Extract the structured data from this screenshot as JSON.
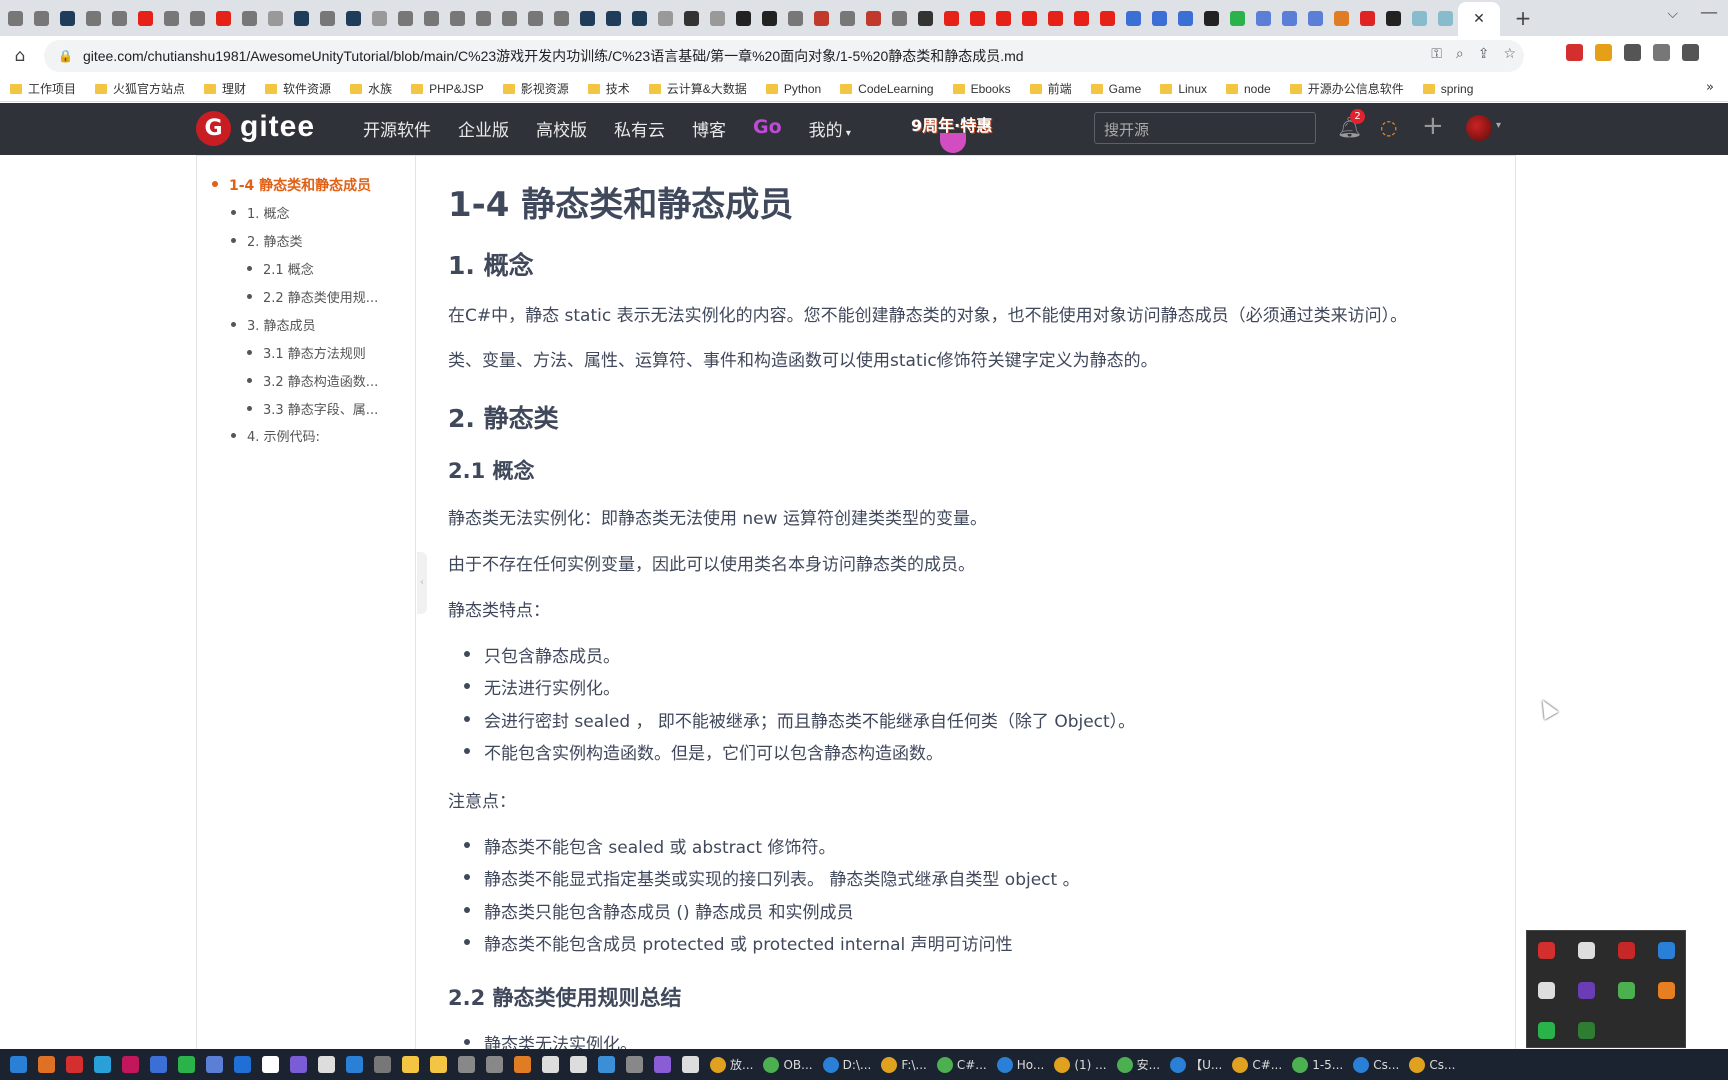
{
  "browser": {
    "active_tab_close": "✕",
    "new_tab": "+",
    "tab_list": "⌵",
    "minimize": "—",
    "url": "gitee.com/chutianshu1981/AwesomeUnityTutorial/blob/main/C%23游戏开发内功训练/C%23语言基础/第一章%20面向对象/1-5%20静态类和静态成员.md",
    "bookmarks": [
      "工作项目",
      "火狐官方站点",
      "理财",
      "软件资源",
      "水族",
      "PHP&JSP",
      "影视资源",
      "技术",
      "云计算&大数据",
      "Python",
      "CodeLearning",
      "Ebooks",
      "前端",
      "Game",
      "Linux",
      "node",
      "开源办公信息软件",
      "spring"
    ],
    "bookmarks_more": "»",
    "tab_favicon_colors": [
      "#777",
      "#777",
      "#1f3d5a",
      "#777",
      "#777",
      "#e62117",
      "#777",
      "#777",
      "#e62117",
      "#777",
      "#999",
      "#1f3d5a",
      "#777",
      "#1f3d5a",
      "#999",
      "#777",
      "#777",
      "#777",
      "#777",
      "#777",
      "#777",
      "#777",
      "#1f3d5a",
      "#1f3d5a",
      "#1f3d5a",
      "#999",
      "#333",
      "#999",
      "#222",
      "#222",
      "#777",
      "#c0392b",
      "#777",
      "#c0392b",
      "#777",
      "#333",
      "#e62117",
      "#e62117",
      "#e62117",
      "#e62117",
      "#e62117",
      "#e62117",
      "#e62117",
      "#3b6fd6",
      "#3b6fd6",
      "#3b6fd6",
      "#222",
      "#2ab34a",
      "#5b7fd6",
      "#5b7fd6",
      "#5b7fd6",
      "#e07c24",
      "#e02424",
      "#222",
      "#8bc",
      "#8bc"
    ],
    "ext_colors": [
      "#d32f2f",
      "#e6a017",
      "#555",
      "#777",
      "#555"
    ]
  },
  "gitee": {
    "logo_text": "gitee",
    "nav": [
      "开源软件",
      "企业版",
      "高校版",
      "私有云",
      "博客"
    ],
    "nav_go": "Go",
    "nav_mine": "我的",
    "promo": "9周年·特惠",
    "search_placeholder": "搜开源",
    "notifications": "2"
  },
  "toc": [
    {
      "label": "1-4 静态类和静态成员",
      "level": 1
    },
    {
      "label": "1. 概念",
      "level": 2
    },
    {
      "label": "2. 静态类",
      "level": 2
    },
    {
      "label": "2.1 概念",
      "level": 3
    },
    {
      "label": "2.2 静态类使用规...",
      "level": 3
    },
    {
      "label": "3. 静态成员",
      "level": 2
    },
    {
      "label": "3.1 静态方法规则",
      "level": 3
    },
    {
      "label": "3.2 静态构造函数...",
      "level": 3
    },
    {
      "label": "3.3 静态字段、属...",
      "level": 3
    },
    {
      "label": "4. 示例代码:",
      "level": 2
    }
  ],
  "doc": {
    "title": "1-4 静态类和静态成员",
    "s1_heading": "1. 概念",
    "s1_p1": "在C#中，静态 static 表示无法实例化的内容。您不能创建静态类的对象，也不能使用对象访问静态成员（必须通过类来访问）。",
    "s1_p2": "类、变量、方法、属性、运算符、事件和构造函数可以使用static修饰符关键字定义为静态的。",
    "s2_heading": "2. 静态类",
    "s21_heading": "2.1 概念",
    "s21_p1": "静态类无法实例化：即静态类无法使用 new 运算符创建类类型的变量。",
    "s21_p2": "由于不存在任何实例变量，因此可以使用类名本身访问静态类的成员。",
    "features_label": "静态类特点：",
    "features": [
      "只包含静态成员。",
      "无法进行实例化。",
      "会进行密封 sealed ， 即不能被继承；而且静态类不能继承自任何类（除了 Object）。",
      "不能包含实例构造函数。但是，它们可以包含静态构造函数。"
    ],
    "notes_label": "注意点：",
    "notes": [
      "静态类不能包含 sealed 或 abstract 修饰符。",
      "静态类不能显式指定基类或实现的接口列表。 静态类隐式继承自类型 object 。",
      "静态类只能包含静态成员 () 静态成员 和实例成员",
      "静态类不能包含成员 protected 或 protected internal 声明可访问性"
    ],
    "s22_heading": "2.2 静态类使用规则总结",
    "s22_first_item": "静态类无法实例化。"
  },
  "taskbar": {
    "windows": [
      "放...",
      "OB...",
      "D:\\...",
      "F:\\...",
      "C#...",
      "Ho...",
      "(1) ...",
      "安...",
      "【U...",
      "C#...",
      "1-5...",
      "Cs...",
      "Cs..."
    ],
    "icon_colors": [
      "#e07024",
      "#d32f2f",
      "#2aa0d8",
      "#c2185b",
      "#3b6fd6",
      "#2ab34a",
      "#5b7fd6",
      "#1f6fd6",
      "#ffffff",
      "#7a5cd6",
      "#ddd",
      "#2a7fd6",
      "#777",
      "#f4c542",
      "#f4c542",
      "#888",
      "#888",
      "#e07c24",
      "#ddd",
      "#ddd",
      "#3b8fd6",
      "#888",
      "#8a5cd6",
      "#ddd"
    ]
  },
  "tray_popup_colors": [
    "#d32f2f",
    "#ddd",
    "#c62828",
    "#2a7fd6",
    "#ddd",
    "#6a3cb6",
    "#4caf50",
    "#e67e22",
    "#2ab34a",
    "#2e7d32"
  ]
}
